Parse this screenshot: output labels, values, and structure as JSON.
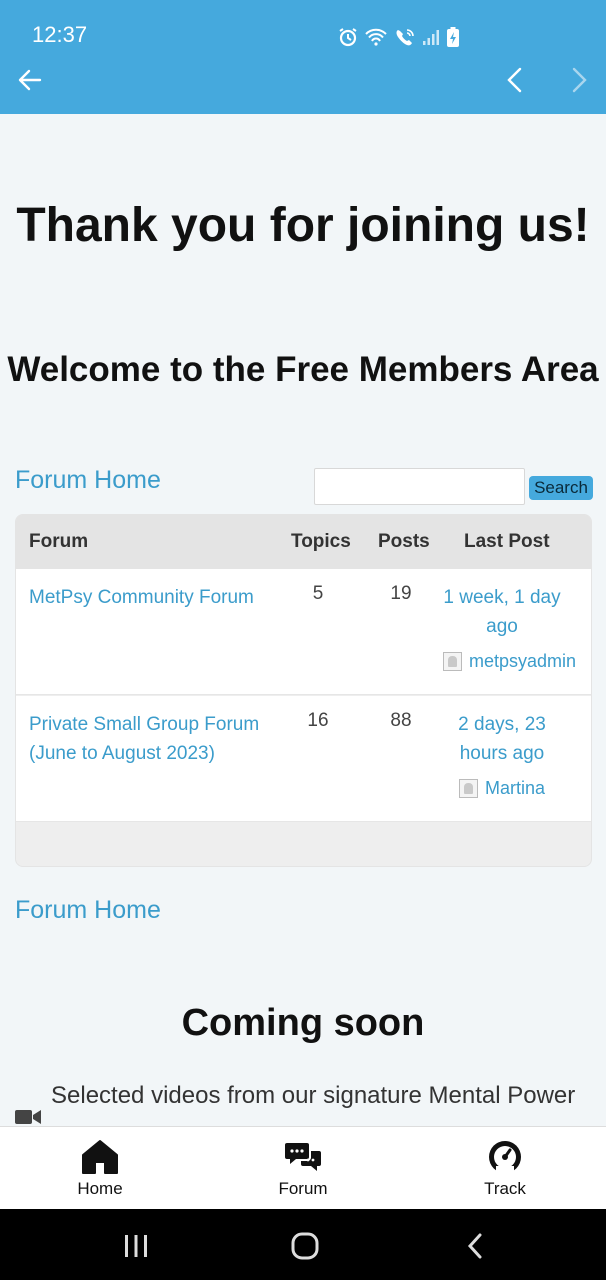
{
  "status_bar": {
    "time": "12:37",
    "icons": [
      "alarm-icon",
      "wifi-icon",
      "wifi-call-icon",
      "signal-icon",
      "battery-charging-icon"
    ],
    "background": "#45a9dd"
  },
  "nav": {
    "icons": [
      "back-arrow-icon",
      "chevron-left-icon",
      "chevron-right-icon"
    ]
  },
  "page": {
    "heading": "Thank you for joining us!",
    "subheading": "Welcome to the Free Members Area"
  },
  "forum": {
    "home_link_top": "Forum Home",
    "home_link_bottom": "Forum Home",
    "search_value": "",
    "search_button": "Search",
    "columns": {
      "forum": "Forum",
      "topics": "Topics",
      "posts": "Posts",
      "last_post": "Last Post"
    },
    "rows": [
      {
        "name": "MetPsy Community Forum",
        "topics": "5",
        "posts": "19",
        "last_post": "1 week, 1 day ago",
        "author": "metpsyadmin"
      },
      {
        "name": "Private Small Group Forum (June to August 2023)",
        "topics": "16",
        "posts": "88",
        "last_post": "2 days, 23 hours ago",
        "author": "Martina"
      }
    ],
    "link_color": "#3b9ccb"
  },
  "coming_soon": {
    "title": "Coming soon",
    "text": "Selected videos from our signature Mental Power"
  },
  "bottom_nav": {
    "items": [
      {
        "label": "Home",
        "icon": "home-icon"
      },
      {
        "label": "Forum",
        "icon": "chat-bubbles-icon"
      },
      {
        "label": "Track",
        "icon": "speedometer-icon"
      }
    ]
  },
  "system_nav": {
    "icons": [
      "recent-apps-icon",
      "home-circle-icon",
      "system-back-icon"
    ]
  }
}
